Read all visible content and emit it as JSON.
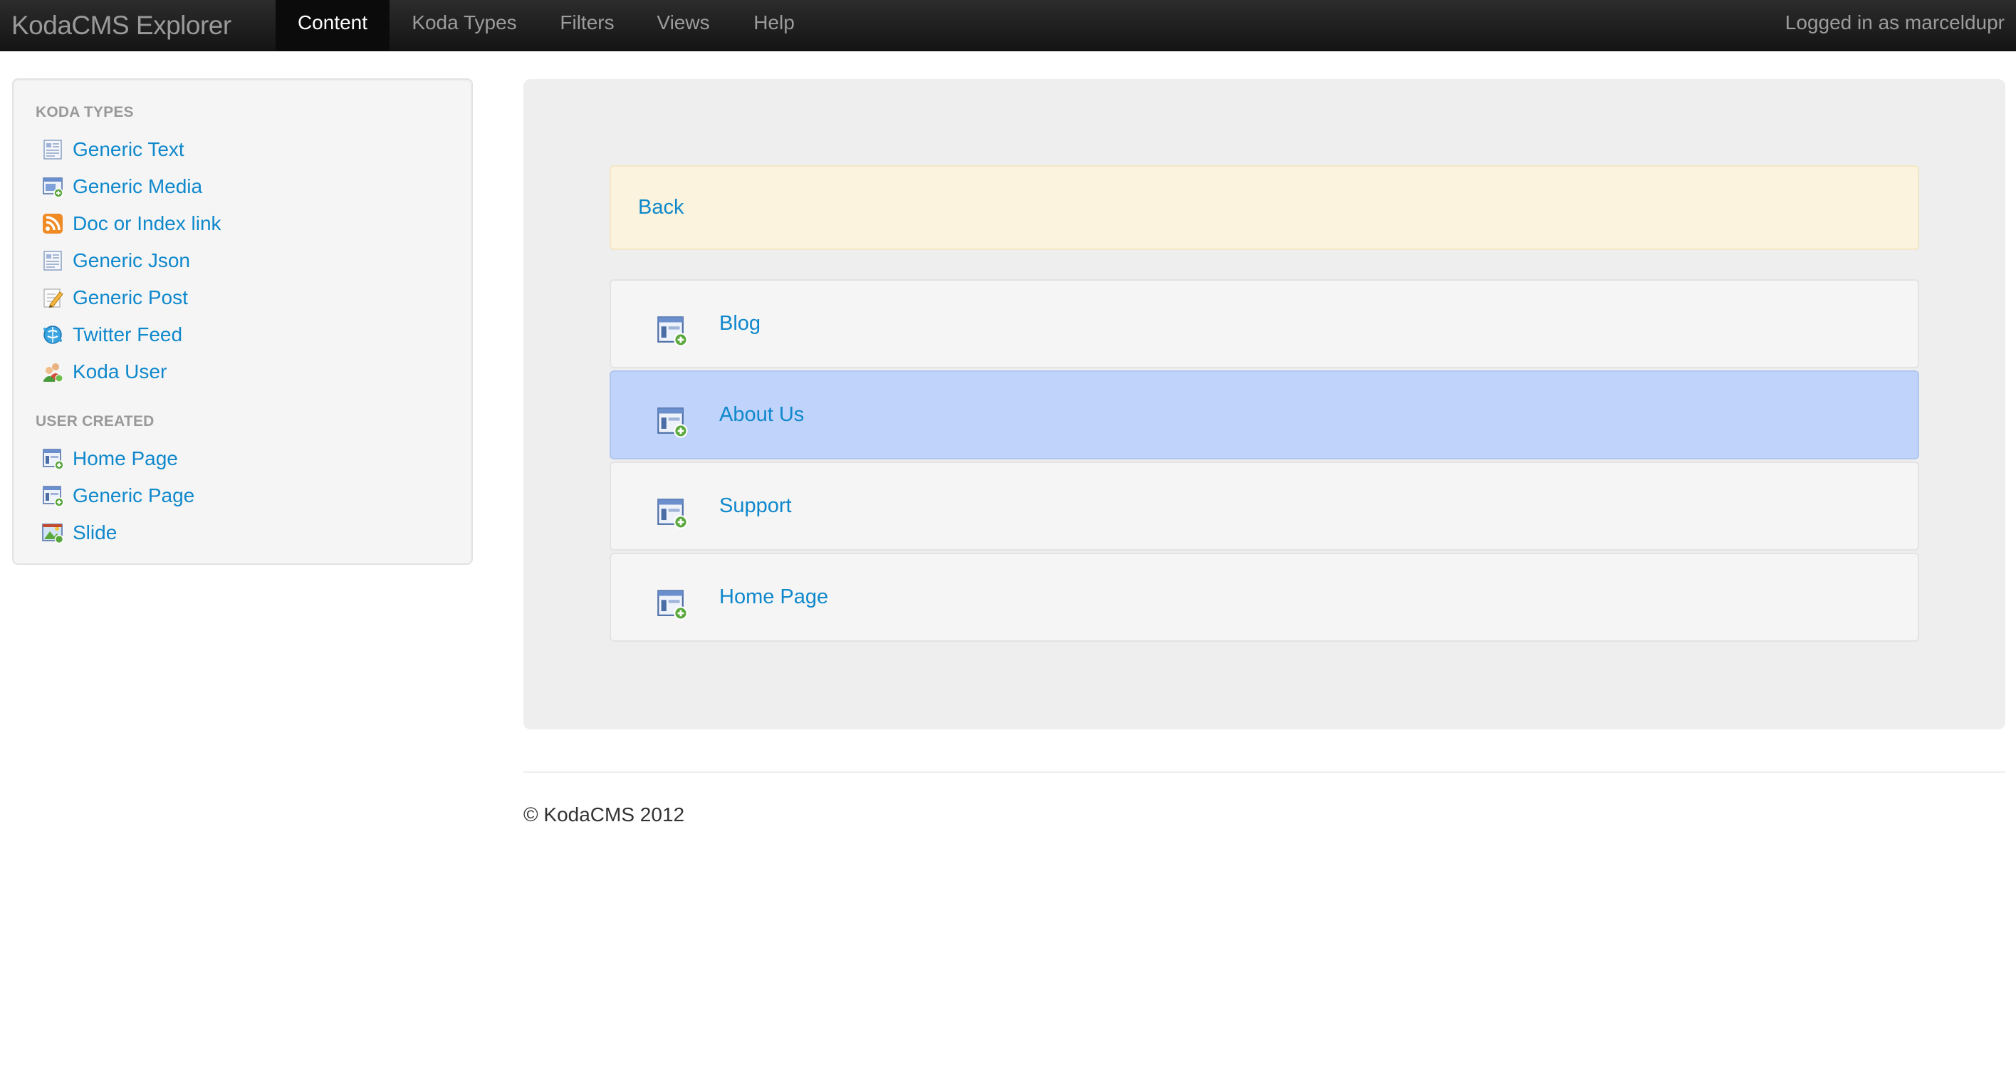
{
  "navbar": {
    "brand": "KodaCMS Explorer",
    "tabs": [
      {
        "label": "Content",
        "active": true
      },
      {
        "label": "Koda Types",
        "active": false
      },
      {
        "label": "Filters",
        "active": false
      },
      {
        "label": "Views",
        "active": false
      },
      {
        "label": "Help",
        "active": false
      }
    ],
    "login_status": "Logged in as marceldupr"
  },
  "sidebar": {
    "koda_types_header": "KODA TYPES",
    "koda_types": [
      {
        "label": "Generic Text",
        "icon": "text-document-icon"
      },
      {
        "label": "Generic Media",
        "icon": "media-icon"
      },
      {
        "label": "Doc or Index link",
        "icon": "rss-feed-icon"
      },
      {
        "label": "Generic Json",
        "icon": "json-document-icon"
      },
      {
        "label": "Generic Post",
        "icon": "pencil-post-icon"
      },
      {
        "label": "Twitter Feed",
        "icon": "twitter-globe-icon"
      },
      {
        "label": "Koda User",
        "icon": "users-icon"
      }
    ],
    "user_created_header": "USER CREATED",
    "user_created": [
      {
        "label": "Home Page",
        "icon": "page-add-icon"
      },
      {
        "label": "Generic Page",
        "icon": "page-add-icon"
      },
      {
        "label": "Slide",
        "icon": "slide-image-icon"
      }
    ]
  },
  "main": {
    "back_label": "Back",
    "items": [
      {
        "label": "Blog",
        "icon": "page-add-icon",
        "selected": false
      },
      {
        "label": "About Us",
        "icon": "page-add-icon",
        "selected": true
      },
      {
        "label": "Support",
        "icon": "page-add-icon",
        "selected": false
      },
      {
        "label": "Home Page",
        "icon": "page-add-icon",
        "selected": false
      }
    ]
  },
  "footer": {
    "copyright": "© KodaCMS 2012"
  },
  "colors": {
    "link": "#0f88cc",
    "selected_row": "#c0d3fa",
    "back_box": "#fbf3dd",
    "navbar": "#1b1b1b"
  }
}
